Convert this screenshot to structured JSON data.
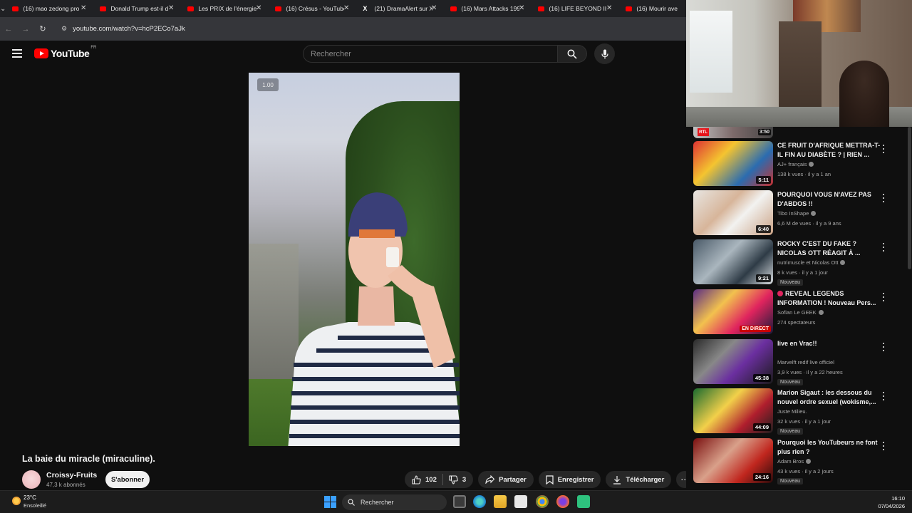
{
  "browser": {
    "tabs": [
      {
        "title": "(16) mao zedong pro",
        "icon": "youtube-icon"
      },
      {
        "title": "Donald Trump est-il d",
        "icon": "youtube-icon"
      },
      {
        "title": "Les PRIX de l'énergie",
        "icon": "youtube-icon"
      },
      {
        "title": "(16) Crésus - YouTube",
        "icon": "youtube-icon"
      },
      {
        "title": "(21) DramaAlert sur X",
        "icon": "x-icon"
      },
      {
        "title": "(16) Mars Attacks 199",
        "icon": "youtube-icon"
      },
      {
        "title": "(16) LIFE BEYOND II:",
        "icon": "youtube-icon"
      },
      {
        "title": "(16) Mourir ave",
        "icon": "youtube-icon"
      }
    ],
    "url": "youtube.com/watch?v=hcP2ECo7aJk"
  },
  "youtube": {
    "logo_text": "YouTube",
    "country_code": "FR",
    "search_placeholder": "Rechercher"
  },
  "video": {
    "speed_label": "1.00",
    "title": "La baie du miracle (miraculine).",
    "channel": "Croissy-Fruits",
    "subscribers": "47,3 k abonnés",
    "subscribe_label": "S'abonner",
    "likes": "102",
    "dislikes": "3",
    "share_label": "Partager",
    "save_label": "Enregistrer",
    "download_label": "Télécharger"
  },
  "sidebar": {
    "partial_item": {
      "duration": "3:50",
      "badge": "RTL"
    },
    "items": [
      {
        "title": "CE FRUIT D'AFRIQUE METTRA-T-IL FIN AU DIABÈTE ? | RIEN ...",
        "channel": "AJ+ français",
        "verified": true,
        "meta": "138 k vues · il y a 1 an",
        "duration": "5:11",
        "badge": ""
      },
      {
        "title": "POURQUOI VOUS N'AVEZ PAS D'ABDOS !!",
        "channel": "Tibo InShape",
        "verified": true,
        "meta": "6,6 M de vues · il y a 9 ans",
        "duration": "6:40",
        "badge": ""
      },
      {
        "title": "ROCKY C'EST DU FAKE ? NICOLAS OTT RÉAGIT À ...",
        "channel": "nutrimuscle et Nicolas Ott",
        "verified": true,
        "meta": "8 k vues · il y a 1 jour",
        "duration": "9:21",
        "badge": "Nouveau"
      },
      {
        "title": "REVEAL LEGENDS INFORMATION ! Nouveau Pers...",
        "channel": "Sofian Le GEEK",
        "verified": true,
        "meta": "274 spectateurs",
        "duration": "EN DIRECT",
        "badge": "",
        "live": true
      },
      {
        "title": "live en Vrac!!",
        "channel": "Marvelft redif live officiel",
        "verified": false,
        "meta": "3,9 k vues · il y a 22 heures",
        "duration": "45:38",
        "badge": "Nouveau"
      },
      {
        "title": "Marion Sigaut : les dessous du nouvel ordre sexuel (wokisme,...",
        "channel": "Juste Milieu.",
        "verified": false,
        "meta": "32 k vues · il y a 1 jour",
        "duration": "44:09",
        "badge": "Nouveau"
      },
      {
        "title": "Pourquoi les YouTubeurs ne font plus rien ?",
        "channel": "Adam Bros",
        "verified": true,
        "meta": "43 k vues · il y a 2 jours",
        "duration": "24:16",
        "badge": "Nouveau"
      }
    ]
  },
  "taskbar": {
    "temperature": "23°C",
    "weather": "Ensoleillé",
    "search_placeholder": "Rechercher",
    "time": "16:10",
    "date": "07/04/2026"
  }
}
